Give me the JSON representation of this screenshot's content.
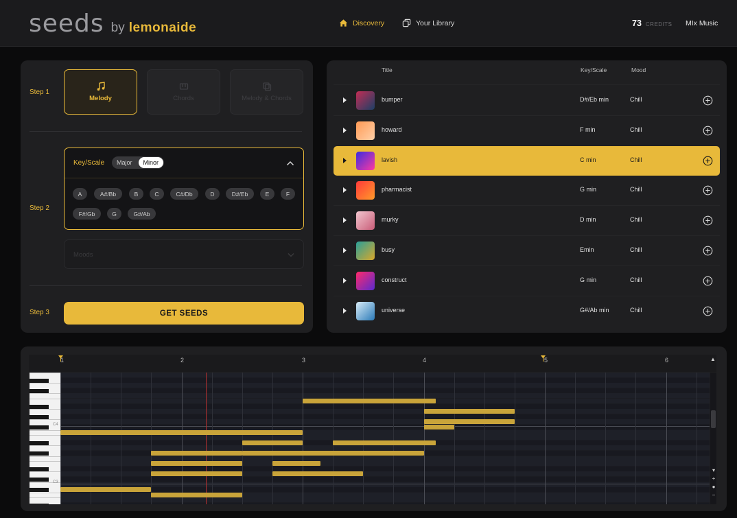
{
  "header": {
    "logo_main": "seeds",
    "logo_by": "by",
    "logo_brand": "lemonaide",
    "nav": [
      {
        "label": "Discovery",
        "icon": "home-icon",
        "active": true
      },
      {
        "label": "Your Library",
        "icon": "library-icon",
        "active": false
      }
    ],
    "credits_count": "73",
    "credits_label": "CREDITS",
    "user_name": "MIx Music"
  },
  "generator": {
    "step1_label": "Step 1",
    "step2_label": "Step 2",
    "step3_label": "Step 3",
    "modes": [
      {
        "label": "Melody",
        "icon": "music-note-icon",
        "selected": true
      },
      {
        "label": "Chords",
        "icon": "piano-icon",
        "selected": false
      },
      {
        "label": "Melody & Chords",
        "icon": "layers-icon",
        "selected": false
      }
    ],
    "keyscale_title": "Key/Scale",
    "scale_options": [
      "Major",
      "Minor"
    ],
    "scale_selected": "Minor",
    "keys": [
      "A",
      "A#/Bb",
      "B",
      "C",
      "C#/Db",
      "D",
      "D#/Eb",
      "E",
      "F",
      "F#/Gb",
      "G",
      "G#/Ab"
    ],
    "moods_placeholder": "Moods",
    "get_seeds_label": "GET SEEDS"
  },
  "results": {
    "columns": {
      "title": "Title",
      "key": "Key/Scale",
      "mood": "Mood"
    },
    "rows": [
      {
        "title": "bumper",
        "key": "D#/Eb min",
        "mood": "Chill",
        "highlighted": false,
        "thumb": [
          "#c22d55",
          "#1c3f66"
        ]
      },
      {
        "title": "howard",
        "key": "F min",
        "mood": "Chill",
        "highlighted": false,
        "thumb": [
          "#ff9a55",
          "#ffd0a8"
        ]
      },
      {
        "title": "lavish",
        "key": "C min",
        "mood": "Chill",
        "highlighted": true,
        "thumb": [
          "#3a2ce0",
          "#ff3aa0"
        ]
      },
      {
        "title": "pharmacist",
        "key": "G min",
        "mood": "Chill",
        "highlighted": false,
        "thumb": [
          "#ff3a3a",
          "#ff9a2a"
        ]
      },
      {
        "title": "murky",
        "key": "D min",
        "mood": "Chill",
        "highlighted": false,
        "thumb": [
          "#f2c6cf",
          "#c95d78"
        ]
      },
      {
        "title": "busy",
        "key": "Emin",
        "mood": "Chill",
        "highlighted": false,
        "thumb": [
          "#2aa09a",
          "#d9a72a"
        ]
      },
      {
        "title": "construct",
        "key": "G min",
        "mood": "Chill",
        "highlighted": false,
        "thumb": [
          "#ff2a6a",
          "#5a2ad0"
        ]
      },
      {
        "title": "universe",
        "key": "G#/Ab min",
        "mood": "Chill",
        "highlighted": false,
        "thumb": [
          "#d8ecf7",
          "#2a7ab8"
        ]
      }
    ]
  },
  "piano_roll": {
    "bar_numbers": [
      "1",
      "2",
      "3",
      "4",
      "5",
      "6"
    ],
    "key_labels": [
      "C4",
      "C3"
    ],
    "playhead_beat": 2.2,
    "notes": [
      {
        "start": 3.0,
        "length": 1.1,
        "pitch": 5
      },
      {
        "start": 4.0,
        "length": 0.75,
        "pitch": 7
      },
      {
        "start": 4.0,
        "length": 0.75,
        "pitch": 9
      },
      {
        "start": 4.0,
        "length": 0.25,
        "pitch": 10
      },
      {
        "start": 1.0,
        "length": 1.75,
        "pitch": 11
      },
      {
        "start": 2.5,
        "length": 0.5,
        "pitch": 11
      },
      {
        "start": 2.5,
        "length": 0.5,
        "pitch": 13
      },
      {
        "start": 3.25,
        "length": 0.85,
        "pitch": 13
      },
      {
        "start": 1.75,
        "length": 0.75,
        "pitch": 15
      },
      {
        "start": 2.5,
        "length": 1.5,
        "pitch": 15
      },
      {
        "start": 1.75,
        "length": 0.75,
        "pitch": 17
      },
      {
        "start": 2.75,
        "length": 0.4,
        "pitch": 17
      },
      {
        "start": 2.75,
        "length": 0.75,
        "pitch": 19
      },
      {
        "start": 1.75,
        "length": 0.75,
        "pitch": 19
      },
      {
        "start": 1.0,
        "length": 0.75,
        "pitch": 22
      },
      {
        "start": 1.75,
        "length": 0.75,
        "pitch": 23
      }
    ]
  },
  "colors": {
    "accent": "#e8b93a",
    "background": "#0b0b0c",
    "panel": "#1f1f21"
  }
}
